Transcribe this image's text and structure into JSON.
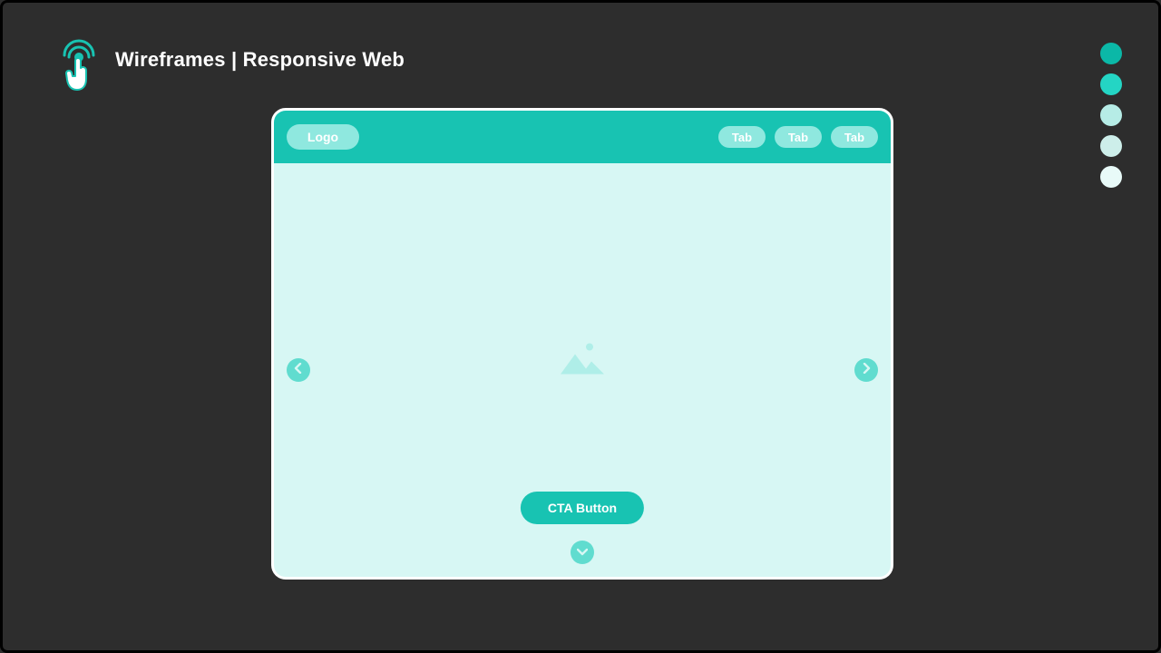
{
  "header": {
    "title": "Wireframes | Responsive Web"
  },
  "palette": {
    "swatches": [
      "#0bb8a7",
      "#24d5c4",
      "#b6ece6",
      "#cdeeea",
      "#e8faf8"
    ]
  },
  "wireframe": {
    "logo_label": "Logo",
    "tabs": [
      "Tab",
      "Tab",
      "Tab"
    ],
    "cta_label": "CTA Button"
  },
  "colors": {
    "accent": "#18c3b2",
    "accent_light": "#8fe8df",
    "panel_bg": "#d7f7f4",
    "nav_circle": "#60dccf"
  }
}
